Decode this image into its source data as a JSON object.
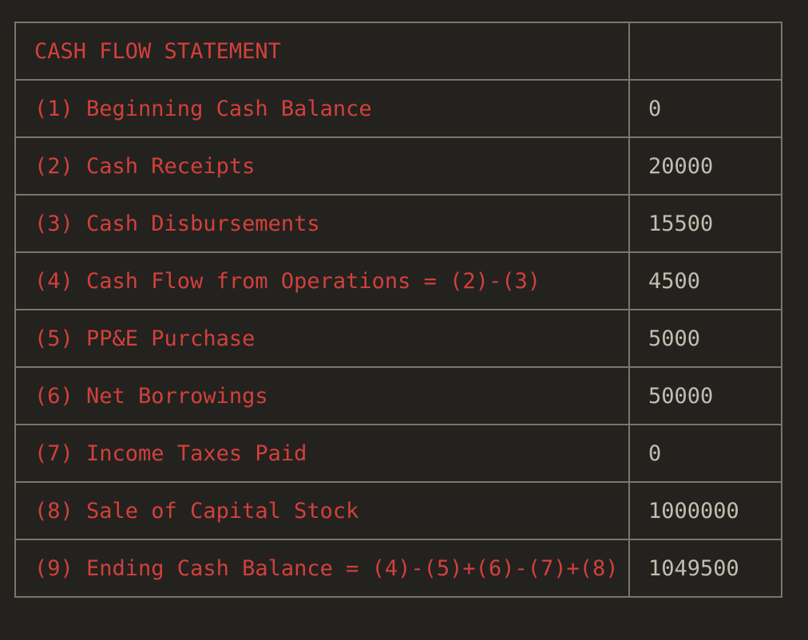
{
  "statement": {
    "title": "CASH FLOW STATEMENT",
    "title_value": "",
    "rows": [
      {
        "label": "(1) Beginning Cash Balance",
        "value": "0"
      },
      {
        "label": "(2) Cash Receipts",
        "value": "20000"
      },
      {
        "label": "(3) Cash Disbursements",
        "value": "15500"
      },
      {
        "label": "(4) Cash Flow from Operations = (2)-(3)",
        "value": "4500"
      },
      {
        "label": "(5) PP&E Purchase",
        "value": "5000"
      },
      {
        "label": "(6) Net Borrowings",
        "value": "50000"
      },
      {
        "label": "(7) Income Taxes Paid",
        "value": "0"
      },
      {
        "label": "(8) Sale of Capital Stock",
        "value": "1000000"
      },
      {
        "label": "(9) Ending Cash Balance = (4)-(5)+(6)-(7)+(8)",
        "value": "1049500"
      }
    ]
  },
  "colors": {
    "background": "#23221e",
    "border": "#77776a",
    "label_text": "#d2403c",
    "value_text": "#bfbfb1"
  }
}
